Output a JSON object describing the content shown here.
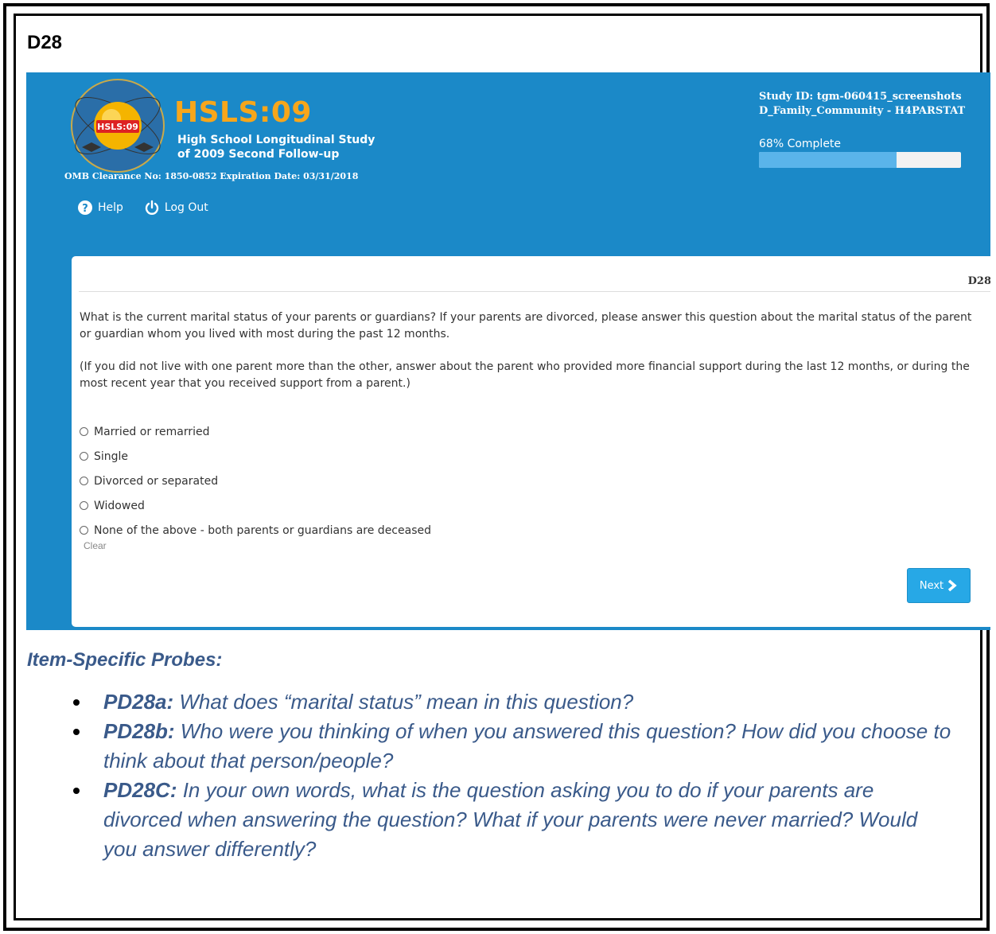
{
  "doc_label": "D28",
  "header": {
    "logo_text": "HSLS:09",
    "brand_title": "HSLS:09",
    "brand_sub1": "High School Longitudinal Study",
    "brand_sub2": "of 2009 Second Follow-up",
    "omb": "OMB Clearance No: 1850-0852 Expiration Date: 03/31/2018",
    "study_line1": "Study ID: tgm-060415_screenshots",
    "study_line2": "D_Family_Community - H4PARSTAT",
    "progress_label": "68% Complete",
    "progress_fraction": 0.68,
    "nav": {
      "help": "Help",
      "logout": "Log Out"
    }
  },
  "question": {
    "id": "D28",
    "text1": "What is the current marital status of your parents or guardians? If your parents are divorced, please answer this question about the marital status of the parent or guardian whom you lived with most during the past 12 months.",
    "text2": "(If you did not live with one parent more than the other, answer about the parent who provided more financial support during the last 12 months, or during the most recent year that you received support from a parent.)",
    "options": [
      "Married or remarried",
      "Single",
      "Divorced or separated",
      "Widowed",
      "None of the above - both parents or guardians are deceased"
    ],
    "clear_label": "Clear",
    "next_label": "Next"
  },
  "probes": {
    "title": "Item-Specific Probes:",
    "items": [
      {
        "key": "PD28a:",
        "text": " What does “marital status” mean in this question?"
      },
      {
        "key": "PD28b:",
        "text": " Who were you thinking of when you answered this question? How did you choose to think about that person/people?"
      },
      {
        "key": "PD28C:",
        "text": " In your own words, what is the question asking you to do if your parents are divorced when answering the question? What if your parents were never married? Would you answer differently?"
      }
    ]
  },
  "colors": {
    "banner": "#1b89c8",
    "brand_accent": "#f7a61b",
    "button": "#27a8e6",
    "probe_text": "#3a5a8a"
  }
}
